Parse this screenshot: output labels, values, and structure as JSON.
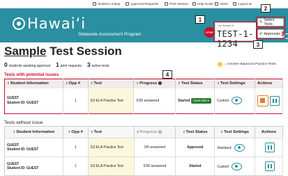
{
  "topbar": {
    "items": [
      {
        "label": "Student Lookup",
        "icon": "search-icon"
      },
      {
        "label": "Approved Requests",
        "icon": "document-icon"
      },
      {
        "label": "Print Session",
        "icon": "print-icon"
      },
      {
        "label": "Help Guide",
        "icon": "help-icon"
      },
      {
        "label": "Alerts",
        "icon": "alert-icon"
      },
      {
        "label": "Logout as",
        "icon": "logout-icon"
      }
    ]
  },
  "header": {
    "brand": "Hawaiʻi",
    "subtitle": "Statewide Assessment Program",
    "session_label": "Live Session ID",
    "session_id": "TEST-1-1234",
    "select_tests_label": "Select Tests",
    "approvals_label": "Approvals",
    "approvals_count": "1",
    "stop_label": "STOP"
  },
  "callouts": [
    "1",
    "2",
    "3",
    "4"
  ],
  "page": {
    "title_prefix": "Sample",
    "title_rest": " Test Session",
    "stats": [
      {
        "num": "0",
        "label": "students awaiting approval"
      },
      {
        "num": "1",
        "label": "print requests"
      },
      {
        "num": "3",
        "label": "active tests"
      }
    ],
    "legend": "= Smarter Balanced Practice Tests",
    "legend_color": "#f4d03f"
  },
  "issues": {
    "heading": "Tests with potential issues",
    "columns": [
      "Student Information",
      "Opp #",
      "Test",
      "Progress",
      "Test Status",
      "Test Settings",
      "Actions"
    ],
    "rows": [
      {
        "name": "GUEST",
        "student_id": "Student ID: GUEST",
        "opp": "1",
        "test": "G3 ELA Practice Test",
        "progress": "0/30 answered",
        "status": "Started",
        "more_info": "more info ▾",
        "settings": "Custom"
      }
    ]
  },
  "noissue": {
    "heading": "Tests without issue",
    "columns": [
      "Student Information",
      "Opp #",
      "Test",
      "Progress",
      "Test Status",
      "Test Settings",
      "Actions"
    ],
    "rows": [
      {
        "name": "GUEST",
        "student_id": "Student ID: GUEST",
        "opp": "1",
        "test": "G3 ELA Practice Test",
        "progress": "0/0 answered",
        "status": "Approved",
        "settings": "Standard"
      },
      {
        "name": "GUEST",
        "student_id": "Student ID: GUEST",
        "opp": "1",
        "test": "G3 ELA Practice Test",
        "progress": "0/30 answered",
        "status": "Started",
        "settings": "Custom"
      }
    ]
  },
  "colors": {
    "header": "#2a8fa0",
    "alert_red": "#c8102e",
    "started_green": "#2e7d32",
    "orange": "#e67e22"
  }
}
